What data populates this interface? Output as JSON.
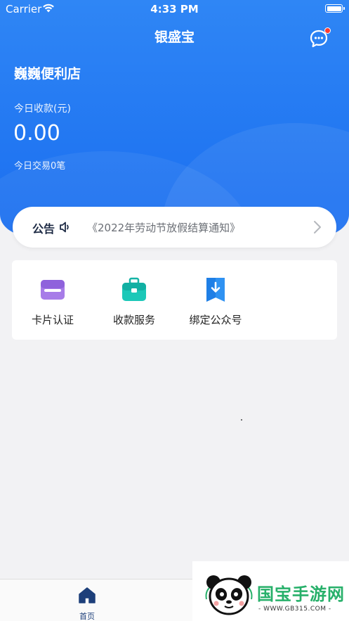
{
  "status_bar": {
    "carrier": "Carrier",
    "time": "4:33 PM"
  },
  "header": {
    "title": "银盛宝"
  },
  "store": {
    "name": "巍巍便利店",
    "today_label": "今日收款(元)",
    "today_amount": "0.00",
    "today_count": "今日交易0笔"
  },
  "notice": {
    "tag": "公告",
    "text": "《2022年劳动节放假结算通知》"
  },
  "services": [
    {
      "label": "卡片认证",
      "icon": "card-icon",
      "color": "#9b6ce0"
    },
    {
      "label": "收款服务",
      "icon": "briefcase-icon",
      "color": "#19c2b4"
    },
    {
      "label": "绑定公众号",
      "icon": "bookmark-download-icon",
      "color": "#2a8cf0"
    }
  ],
  "tabbar": {
    "home_label": "首页"
  },
  "watermark": {
    "title": "国宝手游网",
    "url": "- WWW.GB315.COM -"
  },
  "colors": {
    "primary": "#1a6ef0",
    "accent_red": "#ff3b30",
    "tab_active": "#1d3f7a"
  }
}
